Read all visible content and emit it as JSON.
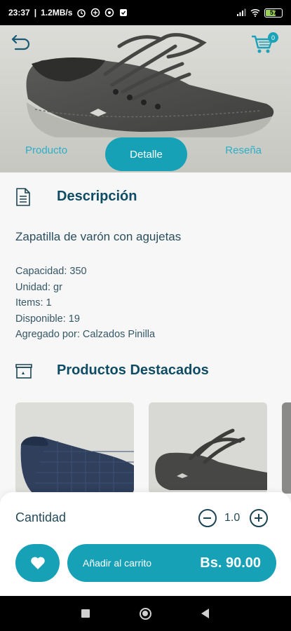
{
  "status_bar": {
    "time": "23:37",
    "speed": "1.2MB/s",
    "battery": "57"
  },
  "header": {
    "cart_count": "0"
  },
  "tabs": {
    "producto": "Producto",
    "detalle": "Detalle",
    "resena": "Reseña"
  },
  "description": {
    "title": "Descripción",
    "text": "Zapatilla de varón con agujetas",
    "specs": [
      "Capacidad: 350",
      "Unidad: gr",
      "Items: 1",
      "Disponible: 19",
      "Agregado por: Calzados Pinilla"
    ]
  },
  "featured": {
    "title": "Productos Destacados"
  },
  "purchase": {
    "quantity_label": "Cantidad",
    "quantity_value": "1.0",
    "add_to_cart_label": "Añadir al carrito",
    "price": "Bs. 90.00"
  },
  "colors": {
    "accent": "#16a1b7",
    "dark_text": "#0f4c63"
  }
}
